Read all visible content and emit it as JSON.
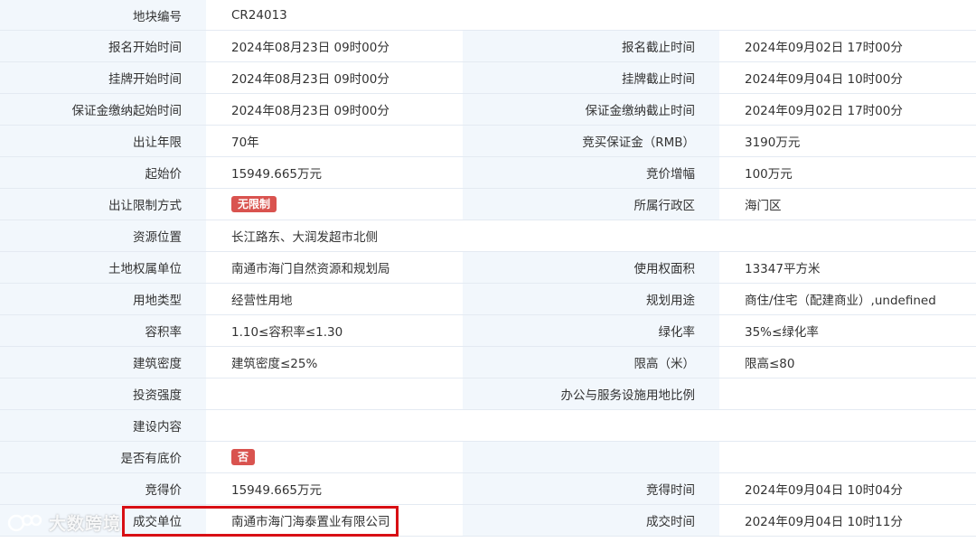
{
  "rows": [
    {
      "l1": "地块编号",
      "v1": "CR24013"
    },
    {
      "l1": "报名开始时间",
      "v1": "2024年08月23日 09时00分",
      "l2": "报名截止时间",
      "v2": "2024年09月02日 17时00分"
    },
    {
      "l1": "挂牌开始时间",
      "v1": "2024年08月23日 09时00分",
      "l2": "挂牌截止时间",
      "v2": "2024年09月04日 10时00分"
    },
    {
      "l1": "保证金缴纳起始时间",
      "v1": "2024年08月23日 09时00分",
      "l2": "保证金缴纳截止时间",
      "v2": "2024年09月02日 17时00分"
    },
    {
      "l1": "出让年限",
      "v1": "70年",
      "l2": "竞买保证金（RMB）",
      "v2": "3190万元"
    },
    {
      "l1": "起始价",
      "v1": "15949.665万元",
      "l2": "竞价增幅",
      "v2": "100万元"
    },
    {
      "l1": "出让限制方式",
      "v1_tag": "无限制",
      "l2": "所属行政区",
      "v2": "海门区"
    },
    {
      "l1": "资源位置",
      "v1": "长江路东、大润发超市北侧"
    },
    {
      "l1": "土地权属单位",
      "v1": "南通市海门自然资源和规划局",
      "l2": "使用权面积",
      "v2": "13347平方米"
    },
    {
      "l1": "用地类型",
      "v1": "经营性用地",
      "l2": "规划用途",
      "v2": "商住/住宅（配建商业）,undefined"
    },
    {
      "l1": "容积率",
      "v1": "1.10≤容积率≤1.30",
      "l2": "绿化率",
      "v2": "35%≤绿化率"
    },
    {
      "l1": "建筑密度",
      "v1": "建筑密度≤25%",
      "l2": "限高（米）",
      "v2": "限高≤80"
    },
    {
      "l1": "投资强度",
      "v1": "",
      "l2": "办公与服务设施用地比例",
      "v2": ""
    },
    {
      "l1": "建设内容",
      "v1": ""
    },
    {
      "l1": "是否有底价",
      "v1_tag": "否",
      "l2": "",
      "v2": ""
    },
    {
      "l1": "竞得价",
      "v1": "15949.665万元",
      "l2": "竞得时间",
      "v2": "2024年09月04日 10时04分"
    },
    {
      "l1": "成交单位",
      "v1": "南通市海门海泰置业有限公司",
      "l2": "成交时间",
      "v2": "2024年09月04日 10时11分"
    }
  ],
  "watermark": {
    "text": "大数跨境"
  },
  "colors": {
    "label_bg": "#f2f7fc",
    "tag_bg": "#d9534f",
    "highlight": "#d80f14"
  }
}
